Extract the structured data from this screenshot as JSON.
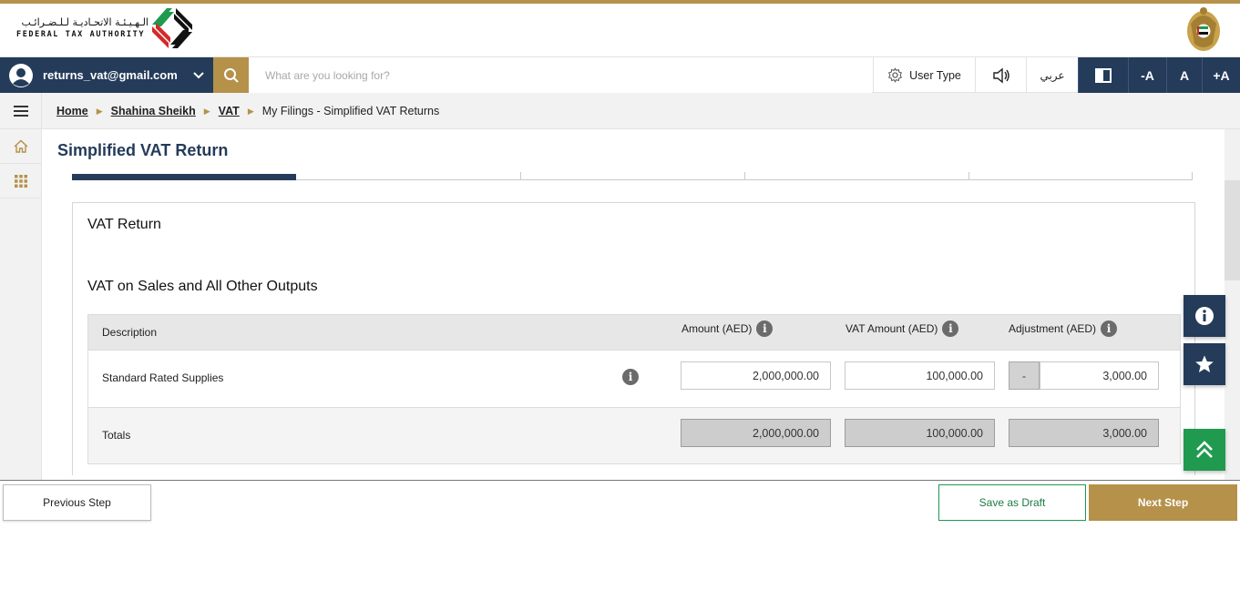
{
  "brand": {
    "name_ar": "الـهـيـئـة الاتحـاديـة لـلـضـرائـب",
    "name_en": "FEDERAL TAX AUTHORITY"
  },
  "colors": {
    "navy": "#243b5a",
    "gold": "#b5914a",
    "green": "#1f9a4f"
  },
  "navbar": {
    "user_email": "returns_vat@gmail.com",
    "search_placeholder": "What are you looking for?",
    "user_type_label": "User Type",
    "language_label": "عربي",
    "font_decrease_label": "-A",
    "font_reset_label": "A",
    "font_increase_label": "+A",
    "icons": [
      "user-avatar-icon",
      "chevron-down-icon",
      "search-icon",
      "gear-icon",
      "speaker-icon",
      "contrast-icon"
    ]
  },
  "breadcrumb": {
    "items": [
      {
        "label": "Home",
        "link": true
      },
      {
        "label": "Shahina Sheikh",
        "link": true
      },
      {
        "label": "VAT",
        "link": true
      },
      {
        "label": "My Filings - Simplified VAT Returns",
        "link": false
      }
    ]
  },
  "sidebar": {
    "icons": [
      "hamburger-icon",
      "home-icon",
      "apps-grid-icon"
    ]
  },
  "main": {
    "page_title": "Simplified VAT Return",
    "stepper": {
      "total_steps": 5,
      "current_step": 1
    },
    "card_title": "VAT Return",
    "section_title": "VAT on Sales and All Other Outputs",
    "table": {
      "headers": {
        "description": "Description",
        "amount": "Amount (AED)",
        "vat_amount": "VAT Amount (AED)",
        "adjustment": "Adjustment (AED)"
      },
      "rows": [
        {
          "description": "Standard Rated Supplies",
          "amount": "2,000,000.00",
          "vat_amount": "100,000.00",
          "adjustment_sign": "-",
          "adjustment": "3,000.00"
        }
      ],
      "totals": {
        "label": "Totals",
        "amount": "2,000,000.00",
        "vat_amount": "100,000.00",
        "adjustment": "3,000.00"
      }
    }
  },
  "floating": {
    "icons": [
      "info-icon",
      "star-icon",
      "double-chevron-up-icon"
    ]
  },
  "footer": {
    "previous_label": "Previous Step",
    "save_draft_label": "Save as Draft",
    "next_label": "Next Step"
  }
}
